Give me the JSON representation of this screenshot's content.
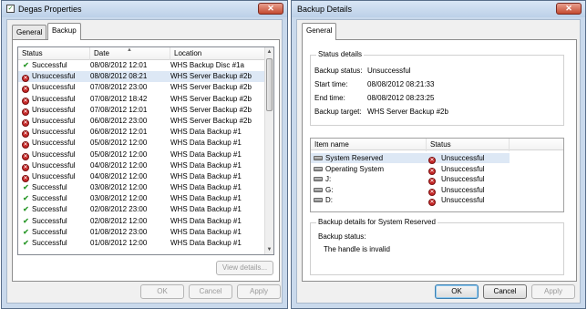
{
  "left_window": {
    "title": "Degas Properties",
    "tabs": [
      {
        "label": "General"
      },
      {
        "label": "Backup"
      }
    ],
    "columns": {
      "status": "Status",
      "date": "Date",
      "location": "Location"
    },
    "rows": [
      {
        "status": "Successful",
        "ok": true,
        "date": "08/08/2012 12:01",
        "location": "WHS Backup Disc #1a"
      },
      {
        "status": "Unsuccessful",
        "ok": false,
        "date": "08/08/2012 08:21",
        "location": "WHS Server Backup #2b"
      },
      {
        "status": "Unsuccessful",
        "ok": false,
        "date": "07/08/2012 23:00",
        "location": "WHS Server Backup #2b"
      },
      {
        "status": "Unsuccessful",
        "ok": false,
        "date": "07/08/2012 18:42",
        "location": "WHS Server Backup #2b"
      },
      {
        "status": "Unsuccessful",
        "ok": false,
        "date": "07/08/2012 12:01",
        "location": "WHS Server Backup #2b"
      },
      {
        "status": "Unsuccessful",
        "ok": false,
        "date": "06/08/2012 23:00",
        "location": "WHS Server Backup #2b"
      },
      {
        "status": "Unsuccessful",
        "ok": false,
        "date": "06/08/2012 12:01",
        "location": "WHS Data Backup #1"
      },
      {
        "status": "Unsuccessful",
        "ok": false,
        "date": "05/08/2012 12:00",
        "location": "WHS Data Backup #1"
      },
      {
        "status": "Unsuccessful",
        "ok": false,
        "date": "05/08/2012 12:00",
        "location": "WHS Data Backup #1"
      },
      {
        "status": "Unsuccessful",
        "ok": false,
        "date": "04/08/2012 12:00",
        "location": "WHS Data Backup #1"
      },
      {
        "status": "Unsuccessful",
        "ok": false,
        "date": "04/08/2012 12:00",
        "location": "WHS Data Backup #1"
      },
      {
        "status": "Successful",
        "ok": true,
        "date": "03/08/2012 12:00",
        "location": "WHS Data Backup #1"
      },
      {
        "status": "Successful",
        "ok": true,
        "date": "03/08/2012 12:00",
        "location": "WHS Data Backup #1"
      },
      {
        "status": "Successful",
        "ok": true,
        "date": "02/08/2012 23:00",
        "location": "WHS Data Backup #1"
      },
      {
        "status": "Successful",
        "ok": true,
        "date": "02/08/2012 12:00",
        "location": "WHS Data Backup #1"
      },
      {
        "status": "Successful",
        "ok": true,
        "date": "01/08/2012 23:00",
        "location": "WHS Data Backup #1"
      },
      {
        "status": "Successful",
        "ok": true,
        "date": "01/08/2012 12:00",
        "location": "WHS Data Backup #1"
      }
    ],
    "view_details_label": "View details...",
    "ok_label": "OK",
    "cancel_label": "Cancel",
    "apply_label": "Apply"
  },
  "right_window": {
    "title": "Backup Details",
    "tab_label": "General",
    "status_details_label": "Status details",
    "backup_status_label": "Backup status:",
    "backup_status_value": "Unsuccessful",
    "start_time_label": "Start time:",
    "start_time_value": "08/08/2012 08:21:33",
    "end_time_label": "End time:",
    "end_time_value": "08/08/2012 08:23:25",
    "backup_target_label": "Backup target:",
    "backup_target_value": "WHS Server Backup #2b",
    "items_columns": {
      "name": "Item name",
      "status": "Status"
    },
    "items": [
      {
        "name": "System Reserved",
        "status": "Unsuccessful"
      },
      {
        "name": "Operating System",
        "status": "Unsuccessful"
      },
      {
        "name": "J:",
        "status": "Unsuccessful"
      },
      {
        "name": "G:",
        "status": "Unsuccessful"
      },
      {
        "name": "D:",
        "status": "Unsuccessful"
      }
    ],
    "details_label": "Backup details for System Reserved",
    "details_status_label": "Backup status:",
    "details_message": "The handle is invalid",
    "ok_label": "OK",
    "cancel_label": "Cancel",
    "apply_label": "Apply"
  },
  "colors": {
    "success": "#2e9a2e",
    "error": "#c62828",
    "selection": "#dde8f5"
  }
}
